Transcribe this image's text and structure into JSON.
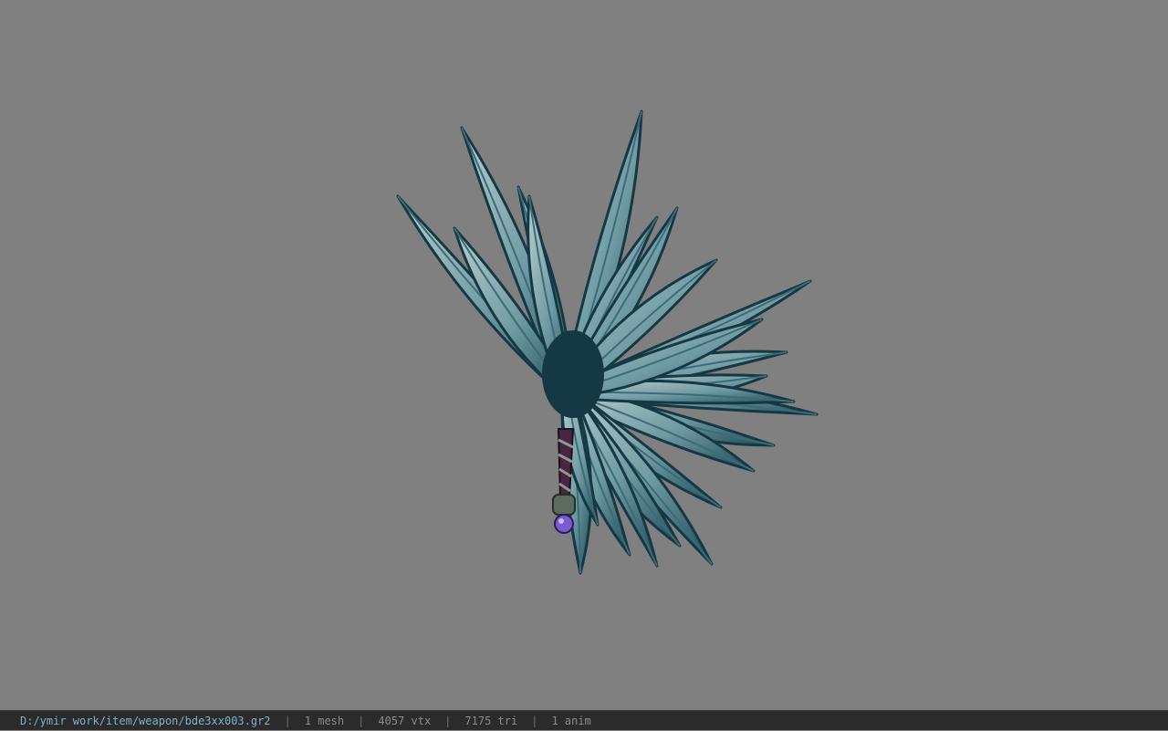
{
  "viewer": {
    "model": {
      "icon": "weapon-model-3d",
      "colors": {
        "blade_dark": "#143844",
        "blade_mid": "#3d6b78",
        "blade_light": "#a9c2c2",
        "handle": "#5a2a4a",
        "gem": "#7a5ad0"
      }
    }
  },
  "status": {
    "path": "D:/ymir work/item/weapon/bde3xx003.gr2",
    "separator": "|",
    "mesh": "1 mesh",
    "vtx": "4057 vtx",
    "tri": "7175 tri",
    "anim": "1 anim"
  }
}
